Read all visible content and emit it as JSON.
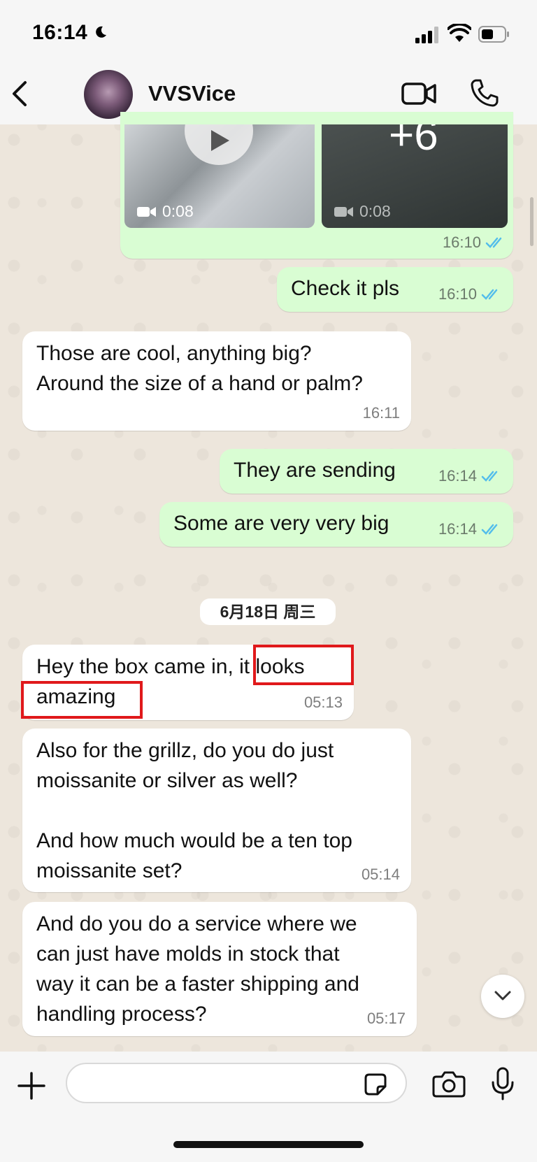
{
  "status_bar": {
    "time": "16:14"
  },
  "header": {
    "contact_name": "VVSVice"
  },
  "media": {
    "video1_duration": "0:08",
    "video2_duration": "0:08",
    "more_count": "+6",
    "time": "16:10"
  },
  "messages": [
    {
      "id": "m1",
      "direction": "out",
      "text": "Check it pls",
      "time": "16:10",
      "read": true
    },
    {
      "id": "m2",
      "direction": "in",
      "text": "Those are cool, anything big?\nAround the size of a hand or palm?",
      "time": "16:11"
    },
    {
      "id": "m3",
      "direction": "out",
      "text": "They are sending",
      "time": "16:14",
      "read": true
    },
    {
      "id": "m4",
      "direction": "out",
      "text": "Some are very very big",
      "time": "16:14",
      "read": true
    },
    {
      "id": "m5",
      "direction": "in",
      "text": "Hey the box came in, it looks\namazing",
      "time": "05:13"
    },
    {
      "id": "m6",
      "direction": "in",
      "text": "Also for the grillz, do you do just\nmoissanite or silver as well?\n\nAnd how much would be a ten top\nmoissanite set?",
      "time": "05:14"
    },
    {
      "id": "m7",
      "direction": "in",
      "text": "And do you do a service where we\ncan just have molds in stock that\nway it can be a faster shipping and\nhandling process?",
      "time": "05:17"
    }
  ],
  "date_separator": "6月18日 周三",
  "composer": {
    "placeholder": ""
  },
  "colors": {
    "outgoing_bubble": "#d9fdd3",
    "incoming_bubble": "#ffffff",
    "read_ticks": "#53bdeb",
    "highlight": "#e0191b"
  },
  "icons": [
    "back-icon",
    "video-call-icon",
    "phone-icon",
    "play-icon",
    "video-camera-icon",
    "double-check-icon",
    "chevron-down-icon",
    "plus-icon",
    "sticker-icon",
    "camera-icon",
    "microphone-icon"
  ]
}
